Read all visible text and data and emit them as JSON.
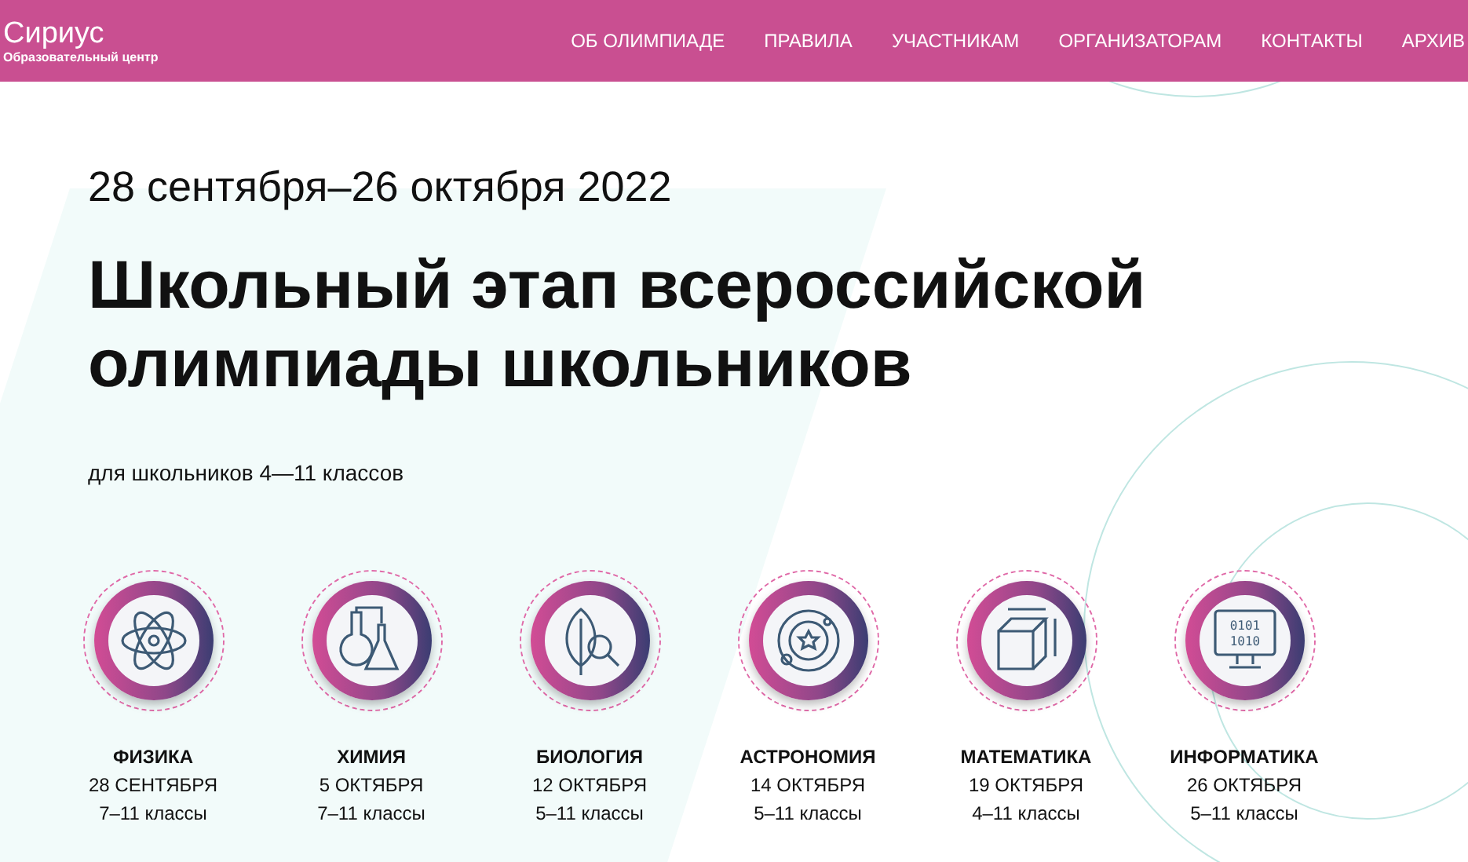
{
  "header": {
    "logo": {
      "name": "Сириус",
      "subtitle": "Образовательный центр"
    },
    "nav": [
      {
        "label": "ОБ ОЛИМПИАДЕ"
      },
      {
        "label": "ПРАВИЛА"
      },
      {
        "label": "УЧАСТНИКАМ"
      },
      {
        "label": "ОРГАНИЗАТОРАМ"
      },
      {
        "label": "КОНТАКТЫ"
      },
      {
        "label": "АРХИВ"
      }
    ]
  },
  "hero": {
    "dates": "28 сентября–26 октября 2022",
    "title": "Школьный этап всероссийской олимпиады школьников",
    "audience": "для школьников 4—11 классов"
  },
  "subjects": [
    {
      "kind": "physics",
      "name": "ФИЗИКА",
      "date": "28 СЕНТЯБРЯ",
      "grades": "7–11 классы"
    },
    {
      "kind": "chemistry",
      "name": "ХИМИЯ",
      "date": "5 ОКТЯБРЯ",
      "grades": "7–11 классы"
    },
    {
      "kind": "biology",
      "name": "БИОЛОГИЯ",
      "date": "12 ОКТЯБРЯ",
      "grades": "5–11 классы"
    },
    {
      "kind": "astronomy",
      "name": "АСТРОНОМИЯ",
      "date": "14 ОКТЯБРЯ",
      "grades": "5–11 классы"
    },
    {
      "kind": "math",
      "name": "МАТЕМАТИКА",
      "date": "19 ОКТЯБРЯ",
      "grades": "4–11 классы"
    },
    {
      "kind": "informatics",
      "name": "ИНФОРМАТИКА",
      "date": "26 ОКТЯБРЯ",
      "grades": "5–11 классы",
      "icon_lines": [
        "0101",
        "1010"
      ]
    }
  ]
}
